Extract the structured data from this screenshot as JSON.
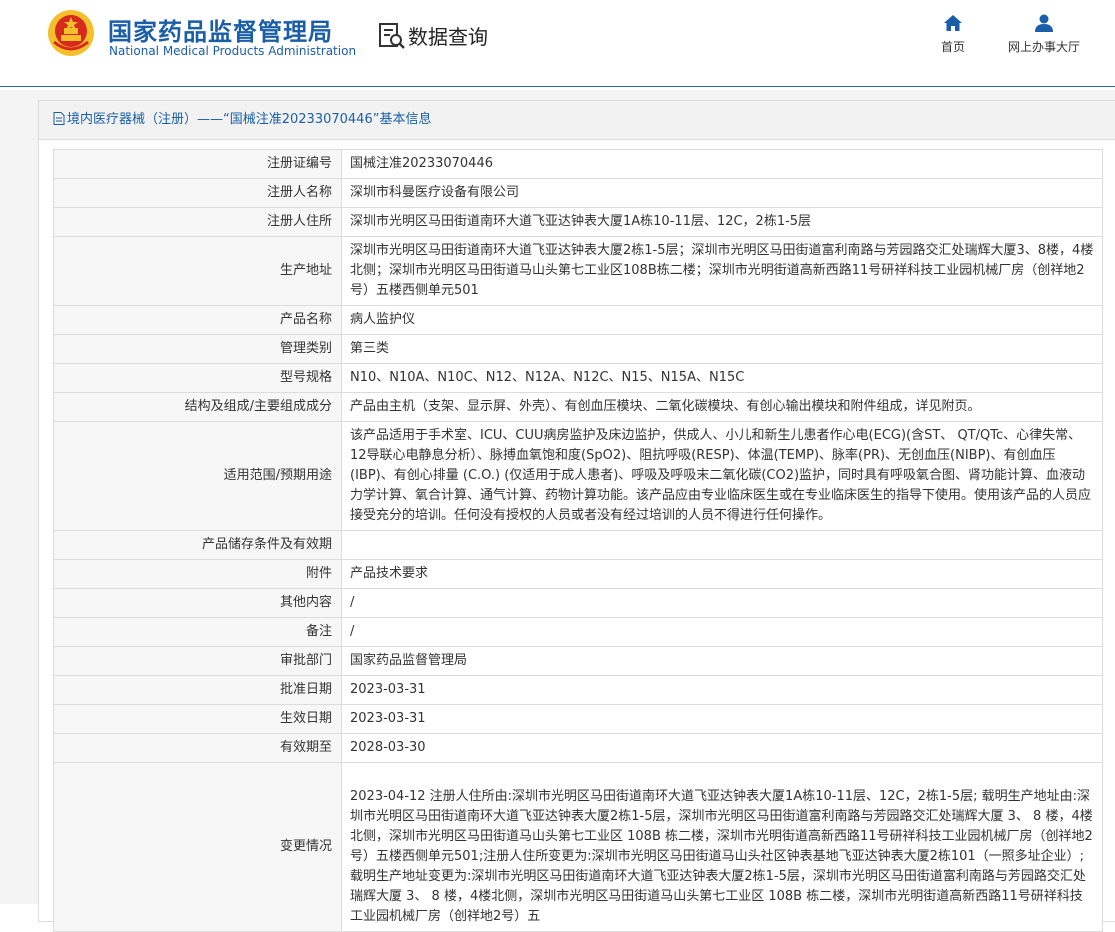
{
  "header": {
    "logo_cn": "国家药品监督管理局",
    "logo_en": "National Medical Products Administration",
    "query_label": "数据查询",
    "nav": [
      {
        "label": "首页",
        "icon": "home-icon"
      },
      {
        "label": "网上办事大厅",
        "icon": "user-icon"
      }
    ]
  },
  "panel": {
    "title": "境内医疗器械（注册）——“国械注准20233070446”基本信息"
  },
  "rows": [
    {
      "label": "注册证编号",
      "value": "国械注准20233070446"
    },
    {
      "label": "注册人名称",
      "value": "深圳市科曼医疗设备有限公司"
    },
    {
      "label": "注册人住所",
      "value": "深圳市光明区马田街道南环大道飞亚达钟表大厦1A栋10-11层、12C，2栋1-5层"
    },
    {
      "label": "生产地址",
      "value": "深圳市光明区马田街道南环大道飞亚达钟表大厦2栋1-5层；深圳市光明区马田街道富利南路与芳园路交汇处瑞辉大厦3、8楼，4楼北侧；深圳市光明区马田街道马山头第七工业区108B栋二楼；深圳市光明街道高新西路11号研祥科技工业园机械厂房（创祥地2号）五楼西侧单元501"
    },
    {
      "label": "产品名称",
      "value": "病人监护仪"
    },
    {
      "label": "管理类别",
      "value": "第三类"
    },
    {
      "label": "型号规格",
      "value": "N10、N10A、N10C、N12、N12A、N12C、N15、N15A、N15C"
    },
    {
      "label": "结构及组成/主要组成成分",
      "value": "产品由主机（支架、显示屏、外壳）、有创血压模块、二氧化碳模块、有创心输出模块和附件组成，详见附页。"
    },
    {
      "label": "适用范围/预期用途",
      "value": "该产品适用于手术室、ICU、CUU病房监护及床边监护，供成人、小儿和新生儿患者作心电(ECG)(含ST、 QT/QTc、心律失常、12导联心电静息分析）、脉搏血氧饱和度(SpO2)、阻抗呼吸(RESP)、体温(TEMP)、脉率(PR)、无创血压(NIBP)、有创血压(IBP)、有创心排量 (C.O.) (仅适用于成人患者)、呼吸及呼吸末二氧化碳(CO2)监护，同时具有呼吸氧合图、肾功能计算、血液动力学计算、氧合计算、通气计算、药物计算功能。该产品应由专业临床医生或在专业临床医生的指导下使用。使用该产品的人员应接受充分的培训。任何没有授权的人员或者没有经过培训的人员不得进行任何操作。"
    },
    {
      "label": "产品储存条件及有效期",
      "value": ""
    },
    {
      "label": "附件",
      "value": "产品技术要求"
    },
    {
      "label": "其他内容",
      "value": "/"
    },
    {
      "label": "备注",
      "value": "/"
    },
    {
      "label": "审批部门",
      "value": "国家药品监督管理局"
    },
    {
      "label": "批准日期",
      "value": "2023-03-31"
    },
    {
      "label": "生效日期",
      "value": "2023-03-31"
    },
    {
      "label": "有效期至",
      "value": "2028-03-30"
    },
    {
      "label": "变更情况",
      "value": "2023-04-12 注册人住所由:深圳市光明区马田街道南环大道飞亚达钟表大厦1A栋10-11层、12C，2栋1-5层; 载明生产地址由:深圳市光明区马田街道南环大道飞亚达钟表大厦2栋1-5层，深圳市光明区马田街道富利南路与芳园路交汇处瑞辉大厦 3、 8 楼，4楼北侧，深圳市光明区马田街道马山头第七工业区 108B 栋二楼，深圳市光明街道高新西路11号研祥科技工业园机械厂房（创祥地2号）五楼西侧单元501;注册人住所变更为:深圳市光明区马田街道马山头社区钟表基地飞亚达钟表大厦2栋101（一照多址企业）; 载明生产地址变更为:深圳市光明区马田街道南环大道飞亚达钟表大厦2栋1-5层，深圳市光明区马田街道富利南路与芳园路交汇处瑞辉大厦 3、 8 楼，4楼北侧，深圳市光明区马田街道马山头第七工业区 108B 栋二楼，深圳市光明街道高新西路11号研祥科技工业园机械厂房（创祥地2号）五"
    }
  ]
}
